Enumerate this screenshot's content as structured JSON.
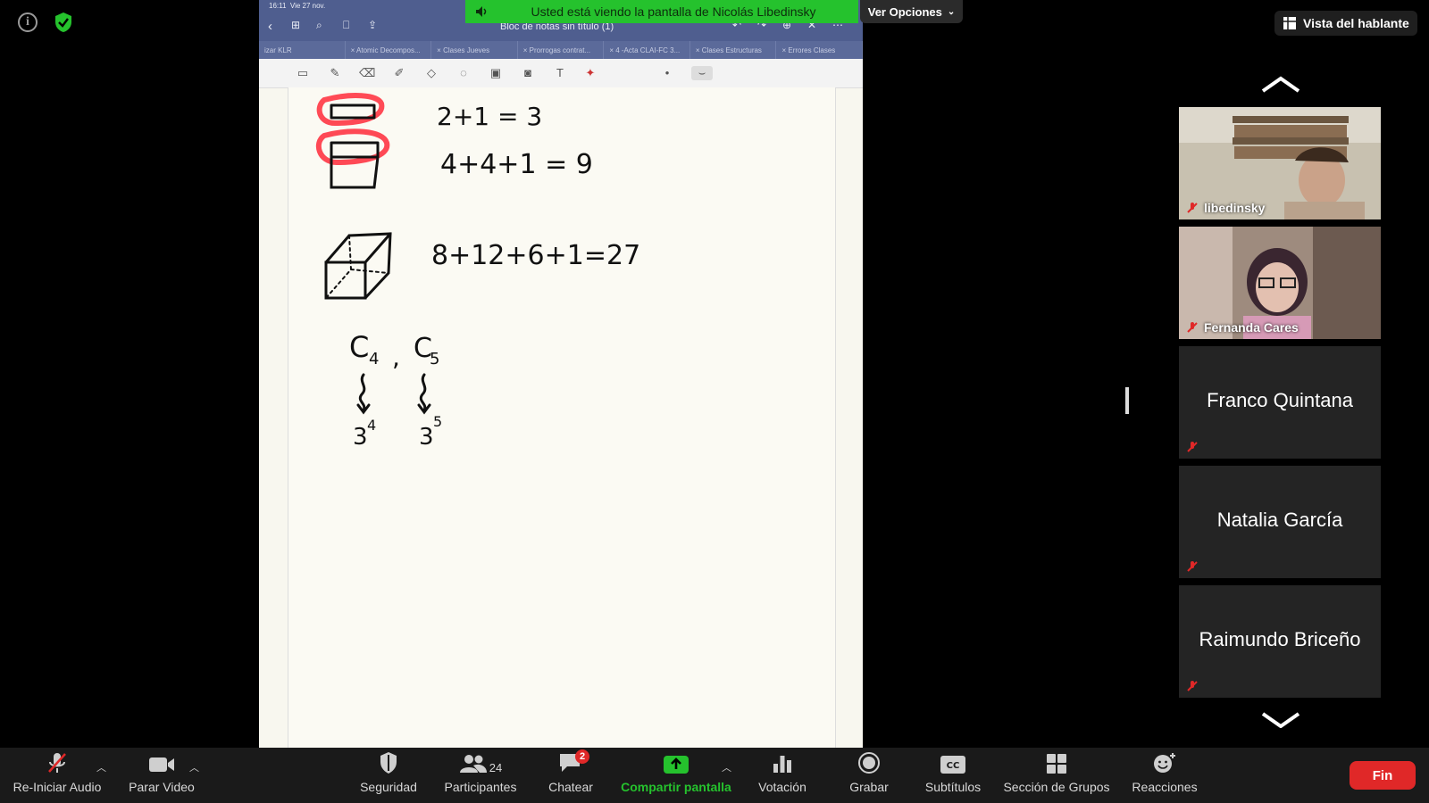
{
  "banner": {
    "text": "Usted está viendo la pantalla de Nicolás Libedinsky",
    "view_options": "Ver Opciones"
  },
  "speaker_view": "Vista del hablante",
  "shared_screen": {
    "status_time": "16:11",
    "status_date": "Vie 27 nov.",
    "doc_title": "Bloc de notas sin título (1)",
    "tabs": [
      "izar KLR",
      "Atomic Decompos...",
      "Clases Jueves",
      "Prorrogas contrat...",
      "4 -Acta CLAI-FC 3...",
      "Clases Estructuras",
      "Errores Clases"
    ],
    "handwriting": {
      "eq1": "2+1 = 3",
      "eq2": "4+4+1 = 9",
      "eq3": "8+12+6+1=27",
      "c4": "C",
      "c4_sub": "4",
      "comma": ",",
      "c5": "C",
      "c5_sub": "5",
      "base1": "3",
      "exp1": "4",
      "base2": "3",
      "exp2": "5"
    }
  },
  "participants": [
    {
      "name": "libedinsky",
      "video": true
    },
    {
      "name": "Fernanda Cares",
      "video": true
    },
    {
      "name": "Franco Quintana",
      "video": false
    },
    {
      "name": "Natalia García",
      "video": false
    },
    {
      "name": "Raimundo Briceño",
      "video": false
    }
  ],
  "toolbar": {
    "audio": "Re-Iniciar Audio",
    "video": "Parar Video",
    "security": "Seguridad",
    "participants": "Participantes",
    "participants_count": "24",
    "chat": "Chatear",
    "chat_badge": "2",
    "share": "Compartir pantalla",
    "poll": "Votación",
    "record": "Grabar",
    "captions": "Subtítulos",
    "breakout": "Sección de Grupos",
    "reactions": "Reacciones",
    "end": "Fin"
  },
  "colors": {
    "share_green": "#25c22d",
    "end_red": "#e02828",
    "toolbar_bg": "#1a1a1a",
    "mute_red": "#e02828"
  }
}
